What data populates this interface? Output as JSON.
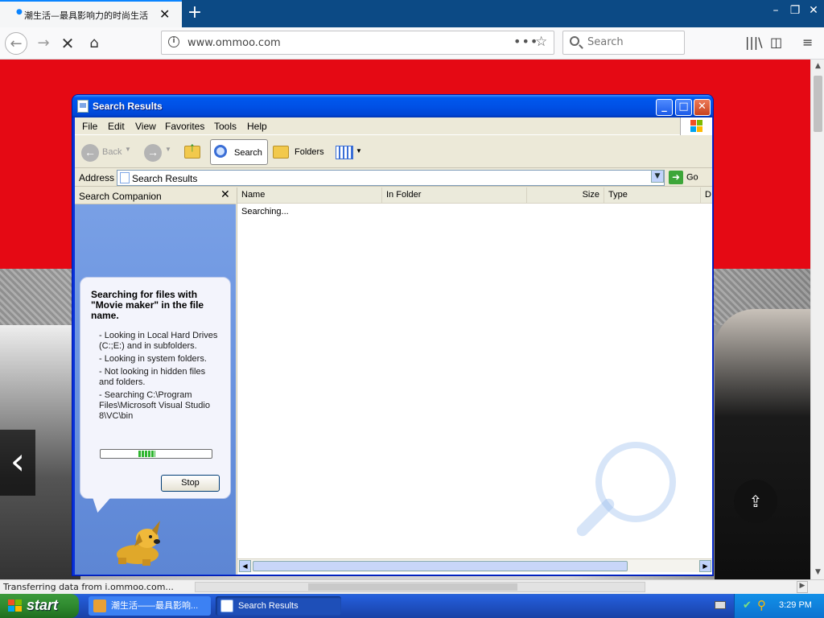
{
  "browser": {
    "tab_title": "潮生活—最具影响力的时尚生活",
    "tab_close": "✕",
    "new_tab": "+",
    "url": "www.ommoo.com",
    "page_actions": "•••",
    "search_placeholder": "Search",
    "status_text": "Transferring data from i.ommoo.com..."
  },
  "webpage": {
    "prev_arrow": "‹",
    "share_icon": "⇪"
  },
  "xp_window": {
    "title": "Search Results",
    "menu": [
      "File",
      "Edit",
      "View",
      "Favorites",
      "Tools",
      "Help"
    ],
    "toolbar": {
      "back": "Back",
      "search": "Search",
      "folders": "Folders"
    },
    "address": {
      "label": "Address",
      "value": "Search Results",
      "go": "Go"
    },
    "companion": {
      "header": "Search Companion",
      "heading": "Searching for files with \"Movie maker\" in the file name.",
      "lines": [
        "- Looking in Local Hard Drives (C:;E:) and in subfolders.",
        "- Looking in system folders.",
        "- Not looking in hidden files and folders.",
        "- Searching C:\\Program Files\\Microsoft Visual Studio 8\\VC\\bin"
      ],
      "stop_label": "Stop",
      "progress_pct": 34
    },
    "results": {
      "columns": [
        "Name",
        "In Folder",
        "Size",
        "Type",
        "D"
      ],
      "status": "Searching..."
    }
  },
  "taskbar": {
    "start_label": "start",
    "items": [
      {
        "label": "潮生活——最具影响...",
        "active": false
      },
      {
        "label": "Search Results",
        "active": true
      }
    ],
    "clock": "3:29 PM"
  },
  "colors": {
    "banner_red": "#e50914",
    "xp_title_blue": "#0054e3",
    "taskbar_blue": "#245edb",
    "start_green": "#3c9a3c"
  }
}
